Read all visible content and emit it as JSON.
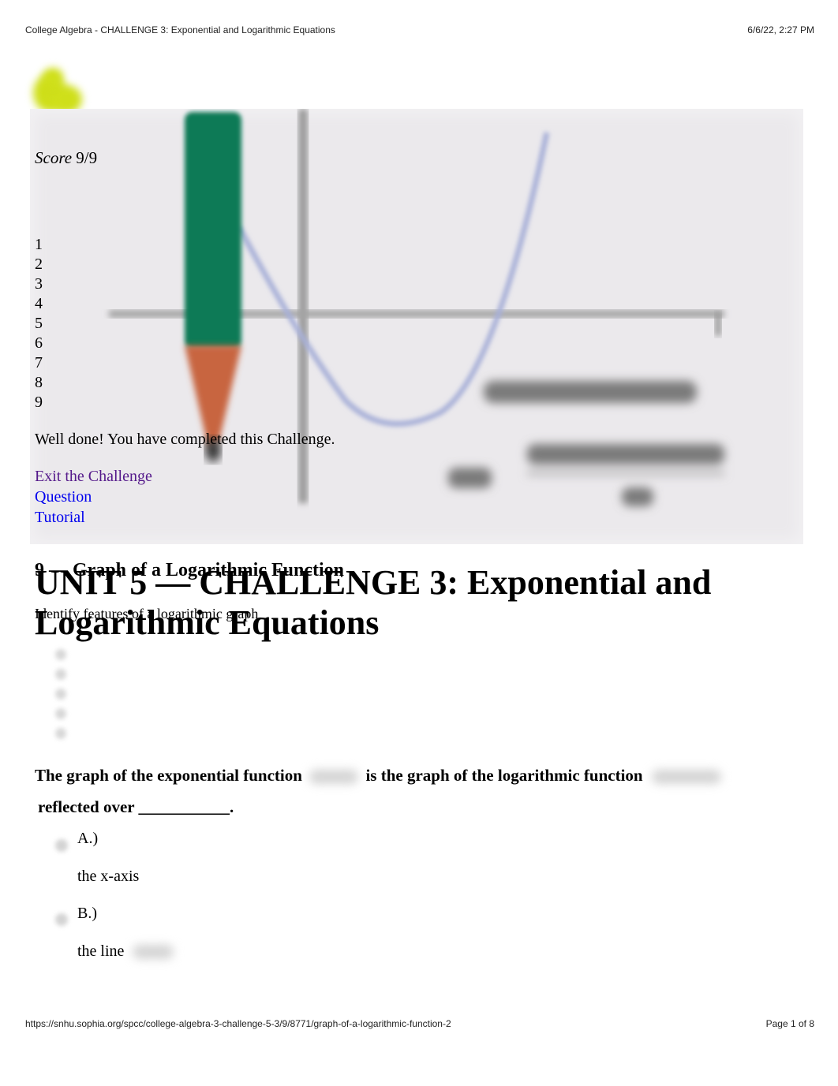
{
  "print_header": {
    "page_title": "College Algebra - CHALLENGE 3: Exponential and Logarithmic Equations",
    "datetime": "6/6/22, 2:27 PM"
  },
  "logo": {
    "icon": "sophia-logo-icon",
    "color": "#cfdf1a"
  },
  "hero_image": {
    "description": "pencil-and-parabola-graph",
    "pencil_colors": [
      "#0c7a56",
      "#c8653f"
    ],
    "curve_color": "#a8b0d8"
  },
  "score": {
    "label": "Score",
    "value": "9/9"
  },
  "question_numbers": [
    "1",
    "2",
    "3",
    "4",
    "5",
    "6",
    "7",
    "8",
    "9"
  ],
  "completion_message": "Well done! You have completed this Challenge.",
  "links": {
    "exit": "Exit the Challenge",
    "question": "Question",
    "tutorial": "Tutorial"
  },
  "question_heading": "9 — Graph of a Logarithmic Function",
  "question_subheading": "Identify features of a logarithmic graph",
  "unit_title": "UNIT 5 — CHALLENGE 3: Exponential and Logarithmic Equations",
  "question": {
    "part1": "The graph of the exponential function",
    "part2": "is the graph of the logarithmic function",
    "part3": "reflected over ___________."
  },
  "options": [
    {
      "letter": "A.)",
      "text": "the x-axis"
    },
    {
      "letter": "B.)",
      "text": "the line"
    }
  ],
  "print_footer": {
    "url": "https://snhu.sophia.org/spcc/college-algebra-3-challenge-5-3/9/8771/graph-of-a-logarithmic-function-2",
    "page": "Page 1 of 8"
  }
}
